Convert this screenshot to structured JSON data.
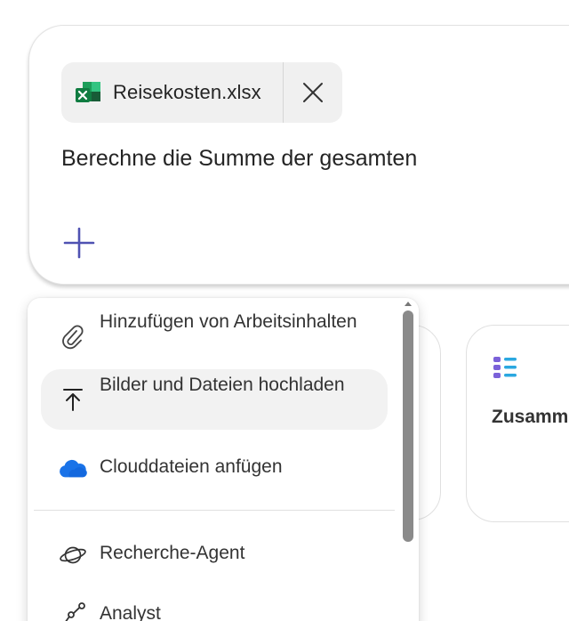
{
  "composer": {
    "attachment": {
      "file_name": "Reisekosten.xlsx",
      "file_icon": "excel-file-icon",
      "remove_icon": "close-icon"
    },
    "prompt_text": "Berechne die Summe der gesamten",
    "add_icon": "plus-icon"
  },
  "suggestions": [
    {
      "title": "",
      "icon": ""
    },
    {
      "title": "Zusamm",
      "icon": "summary-list-icon"
    }
  ],
  "menu": {
    "items": [
      {
        "label": "Hinzufügen von Arbeitsinhalten",
        "icon": "paperclip-icon"
      },
      {
        "label": "Bilder und Dateien hochladen",
        "icon": "upload-icon",
        "highlighted": true
      },
      {
        "label": "Clouddateien anfügen",
        "icon": "cloud-icon"
      },
      {
        "label": "Recherche-Agent",
        "icon": "planet-icon"
      },
      {
        "label": "Analyst",
        "icon": "analyst-chart-icon"
      }
    ]
  },
  "colors": {
    "accent": "#4f52b2",
    "highlight_bg": "#f2f2f2",
    "scrollbar": "#8a8a8a",
    "excel_green": "#1d7a43",
    "cloud_blue": "#1a73e8"
  }
}
